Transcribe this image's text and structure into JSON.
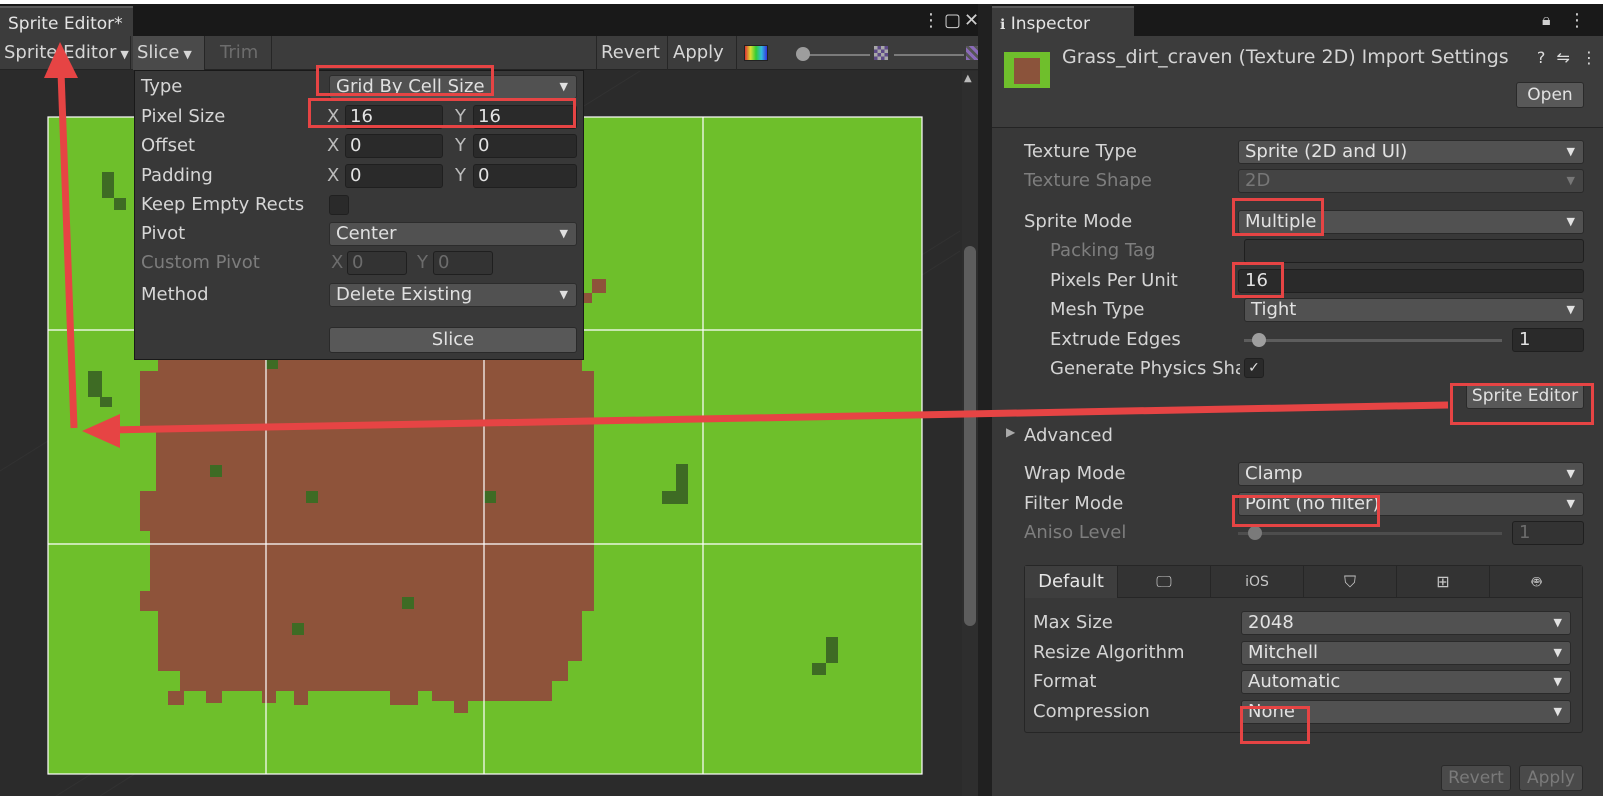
{
  "sprite_editor": {
    "tab_title": "Sprite Editor*",
    "toolbar": {
      "mode_dropdown": "Sprite Editor",
      "slice_dropdown": "Slice",
      "trim": "Trim",
      "revert": "Revert",
      "apply": "Apply"
    },
    "slice_popup": {
      "type_label": "Type",
      "type_value": "Grid By Cell Size",
      "pixel_size_label": "Pixel Size",
      "pixel_size_x": "16",
      "pixel_size_y": "16",
      "offset_label": "Offset",
      "offset_x": "0",
      "offset_y": "0",
      "padding_label": "Padding",
      "padding_x": "0",
      "padding_y": "0",
      "keep_empty_label": "Keep Empty Rects",
      "keep_empty_checked": false,
      "pivot_label": "Pivot",
      "pivot_value": "Center",
      "custom_pivot_label": "Custom Pivot",
      "custom_pivot_x": "0",
      "custom_pivot_y": "0",
      "method_label": "Method",
      "method_value": "Delete Existing",
      "slice_button": "Slice",
      "axis_x": "X",
      "axis_y": "Y"
    },
    "colors": {
      "grass": "#6ebf2b",
      "dirt": "#8e533a",
      "dark_grass": "#3e6b24",
      "grid_line": "#ffffff"
    }
  },
  "inspector": {
    "tab_title": "Inspector",
    "asset_title": "Grass_dirt_craven (Texture 2D) Import Settings",
    "open_button": "Open",
    "texture_type_label": "Texture Type",
    "texture_type_value": "Sprite (2D and UI)",
    "texture_shape_label": "Texture Shape",
    "texture_shape_value": "2D",
    "sprite_mode_label": "Sprite Mode",
    "sprite_mode_value": "Multiple",
    "packing_tag_label": "Packing Tag",
    "packing_tag_value": "",
    "pixels_per_unit_label": "Pixels Per Unit",
    "pixels_per_unit_value": "16",
    "mesh_type_label": "Mesh Type",
    "mesh_type_value": "Tight",
    "extrude_edges_label": "Extrude Edges",
    "extrude_edges_value": "1",
    "generate_physics_label": "Generate Physics Sha",
    "generate_physics_checked": true,
    "sprite_editor_button": "Sprite Editor",
    "advanced_label": "Advanced",
    "wrap_mode_label": "Wrap Mode",
    "wrap_mode_value": "Clamp",
    "filter_mode_label": "Filter Mode",
    "filter_mode_value": "Point (no filter)",
    "aniso_level_label": "Aniso Level",
    "aniso_level_value": "1",
    "platform_tabs": [
      "Default",
      "monitor-icon",
      "iOS",
      "html5-icon",
      "windows-icon",
      "android-icon"
    ],
    "platform_default": "Default",
    "platform_ios": "iOS",
    "max_size_label": "Max Size",
    "max_size_value": "2048",
    "resize_algorithm_label": "Resize Algorithm",
    "resize_algorithm_value": "Mitchell",
    "format_label": "Format",
    "format_value": "Automatic",
    "compression_label": "Compression",
    "compression_value": "None",
    "revert_button": "Revert",
    "apply_button": "Apply"
  },
  "annotation_color": "#e64444"
}
